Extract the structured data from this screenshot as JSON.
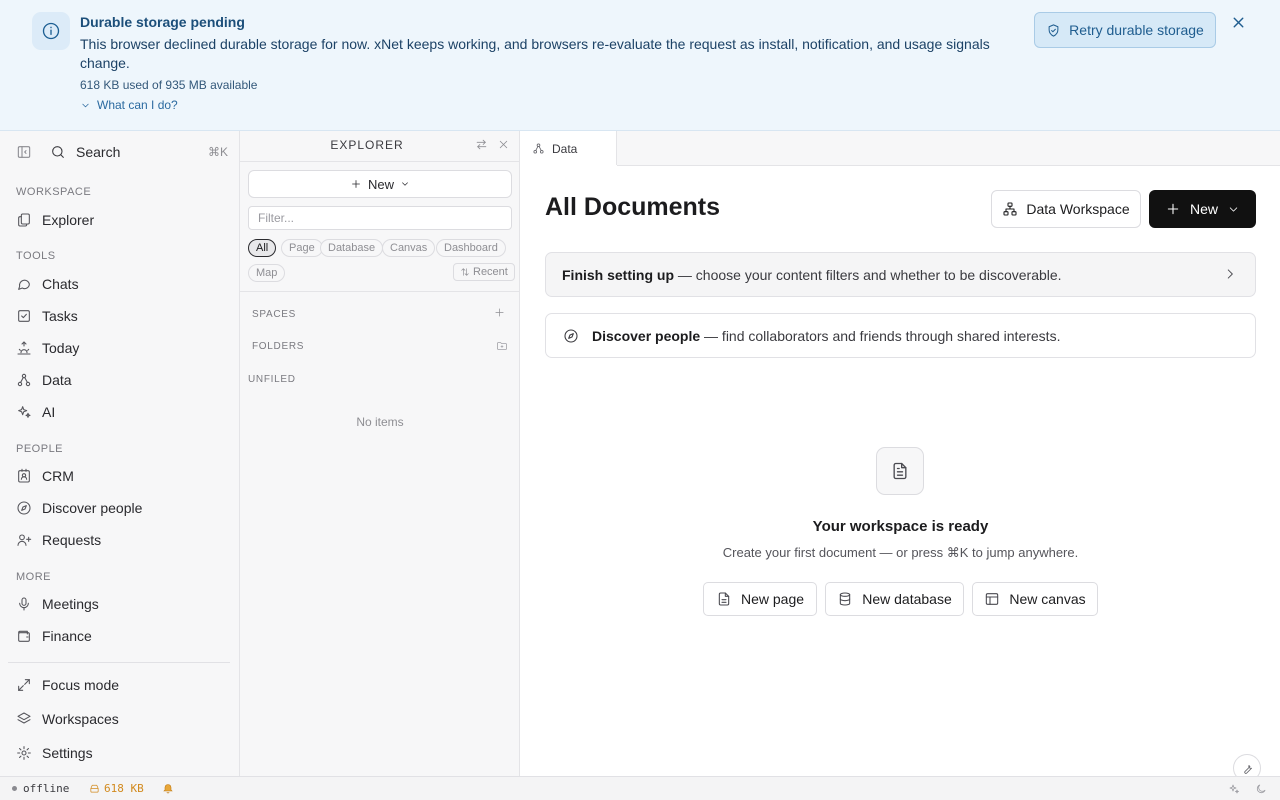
{
  "banner": {
    "title": "Durable storage pending",
    "body": "This browser declined durable storage for now. xNet keeps working, and browsers re-evaluate the request as install, notification, and usage signals change.",
    "usage": "618 KB used of 935 MB available",
    "help_link": "What can I do?",
    "retry_label": "Retry durable storage",
    "icons": {
      "info": "info-icon",
      "retry": "shield-check-icon",
      "close": "close-icon"
    },
    "colors": {
      "background": "#eef6fc",
      "accent": "#1f5d8f"
    }
  },
  "sidebar": {
    "search": {
      "label": "Search",
      "shortcut": "⌘K"
    },
    "sections": {
      "workspace": "WORKSPACE",
      "tools": "TOOLS",
      "people": "PEOPLE",
      "more": "MORE"
    },
    "items": {
      "explorer": "Explorer",
      "chats": "Chats",
      "tasks": "Tasks",
      "today": "Today",
      "data": "Data",
      "ai": "AI",
      "crm": "CRM",
      "discover_people": "Discover people",
      "requests": "Requests",
      "meetings": "Meetings",
      "finance": "Finance",
      "focus_mode": "Focus mode",
      "workspaces": "Workspaces",
      "settings": "Settings"
    }
  },
  "explorer": {
    "title": "EXPLORER",
    "new_label": "New",
    "filter_placeholder": "Filter...",
    "chips": {
      "all": "All",
      "page": "Page",
      "database": "Database",
      "canvas": "Canvas",
      "dashboard": "Dashboard",
      "map": "Map"
    },
    "active_chip": "All",
    "sort_label": "Recent",
    "sections": {
      "spaces": "SPACES",
      "folders": "FOLDERS",
      "unfiled": "UNFILED"
    },
    "empty_text": "No items"
  },
  "main": {
    "tab_label": "Data",
    "title": "All Documents",
    "data_workspace_label": "Data Workspace",
    "new_label": "New",
    "setup_card": {
      "bold": "Finish setting up",
      "rest": " — choose your content filters and whether to be discoverable."
    },
    "discover_card": {
      "bold": "Discover people",
      "rest": " — find collaborators and friends through shared interests."
    },
    "empty_state": {
      "title": "Your workspace is ready",
      "subtitle": "Create your first document — or press ⌘K to jump anywhere."
    },
    "quick_actions": {
      "new_page": "New page",
      "new_database": "New database",
      "new_canvas": "New canvas"
    }
  },
  "statusbar": {
    "connection": "offline",
    "storage": "618 KB",
    "colors": {
      "warning": "#d28a1e"
    }
  }
}
